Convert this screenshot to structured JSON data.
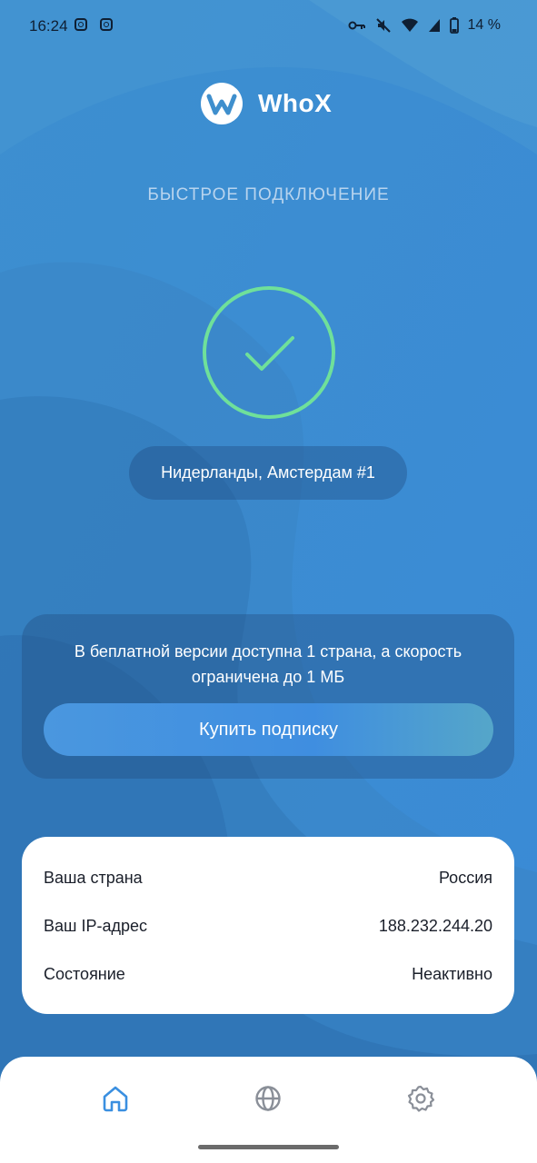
{
  "status_bar": {
    "time": "16:24",
    "battery_percent": "14 %",
    "icons": [
      "instagram-icon",
      "instagram-icon",
      "vpn-key-icon",
      "mute-icon",
      "wifi-icon",
      "signal-icon",
      "battery-icon"
    ]
  },
  "header": {
    "app_name": "WhoX",
    "logo_icon": "whox-logo-icon"
  },
  "quick_connect": {
    "title": "БЫСТРОЕ ПОДКЛЮЧЕНИЕ",
    "state_icon": "check-icon",
    "accent_color": "#6fe09a",
    "server": "Нидерланды, Амстердам #1"
  },
  "promo": {
    "text": "В беплатной версии доступна 1 страна, а скорость ограничена до 1 МБ",
    "button_label": "Купить подписку"
  },
  "info": {
    "rows": [
      {
        "label": "Ваша страна",
        "value": "Россия"
      },
      {
        "label": "Ваш IP-адрес",
        "value": "188.232.244.20"
      },
      {
        "label": "Состояние",
        "value": "Неактивно"
      }
    ]
  },
  "bottom_nav": {
    "items": [
      {
        "icon": "home-icon",
        "active": true,
        "color": "#3a8fe0"
      },
      {
        "icon": "globe-icon",
        "active": false,
        "color": "#8a8f98"
      },
      {
        "icon": "settings-icon",
        "active": false,
        "color": "#8a8f98"
      }
    ]
  }
}
